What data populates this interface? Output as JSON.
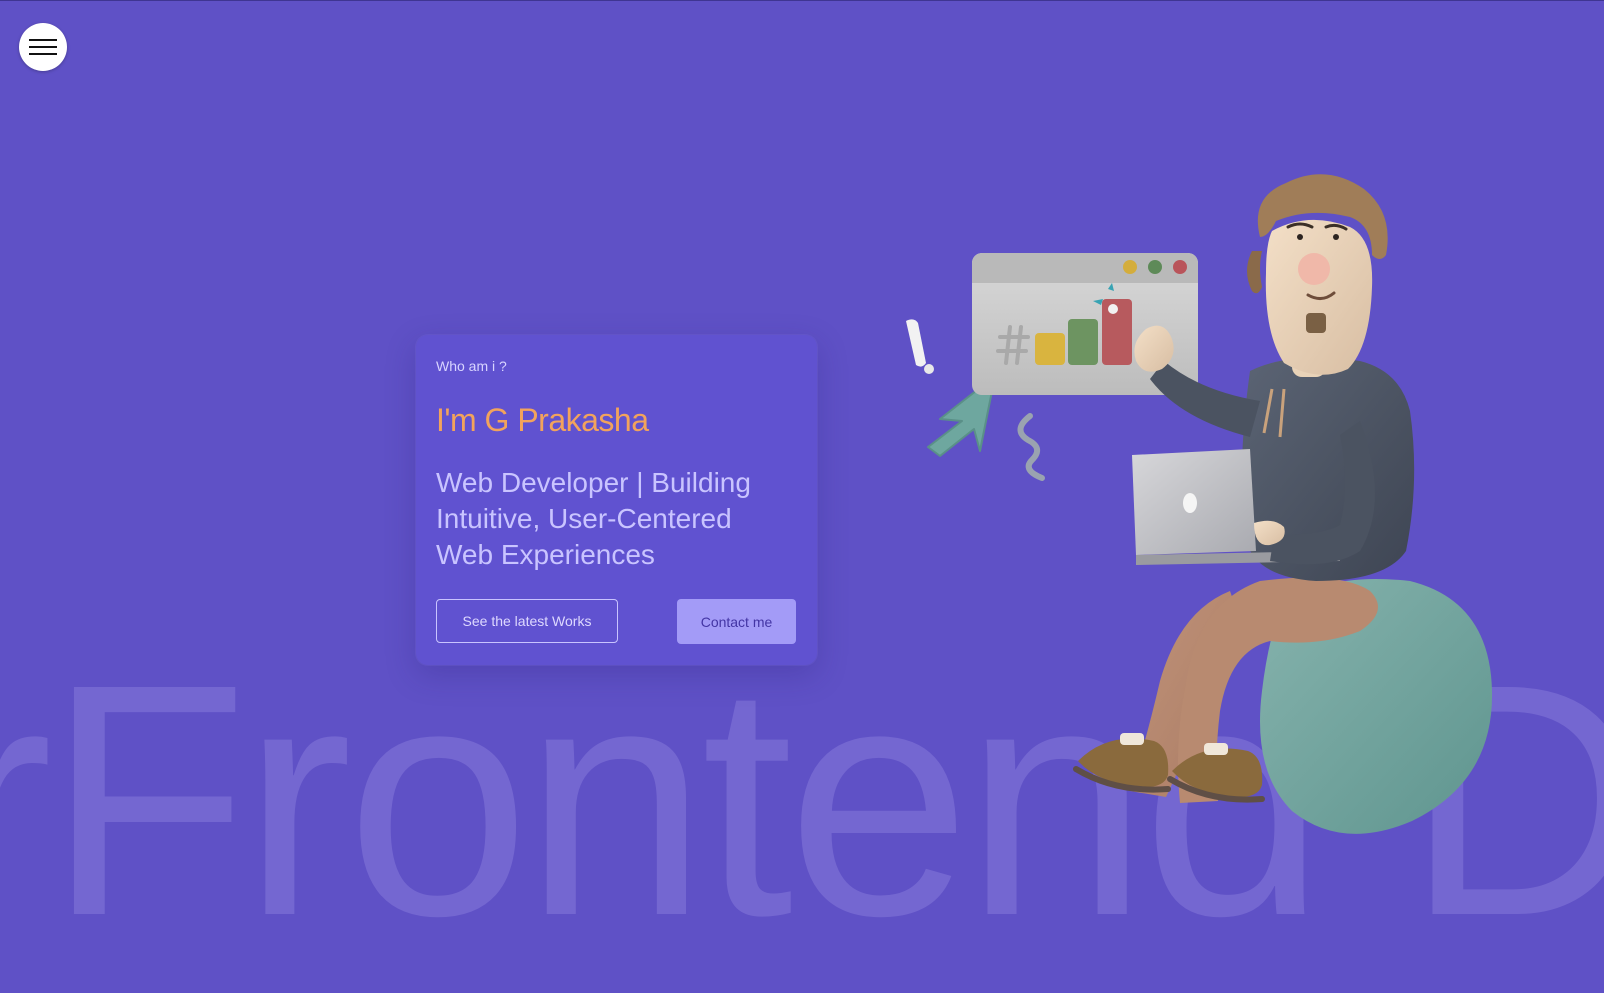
{
  "menu": {
    "icon": "hamburger-menu-icon"
  },
  "hero": {
    "eyebrow": "Who am i ?",
    "name": "I'm G Prakasha",
    "tagline": "Web Developer | Building Intuitive, User-Centered Web Experiences",
    "buttons": {
      "works_label": "See the latest Works",
      "contact_label": "Contact me"
    }
  },
  "background_text": "rFrontend D",
  "colors": {
    "background": "#5f51c6",
    "accent_name": "#f2a35c",
    "tagline": "#c9c4ff",
    "contact_button": "#a39bf7"
  }
}
